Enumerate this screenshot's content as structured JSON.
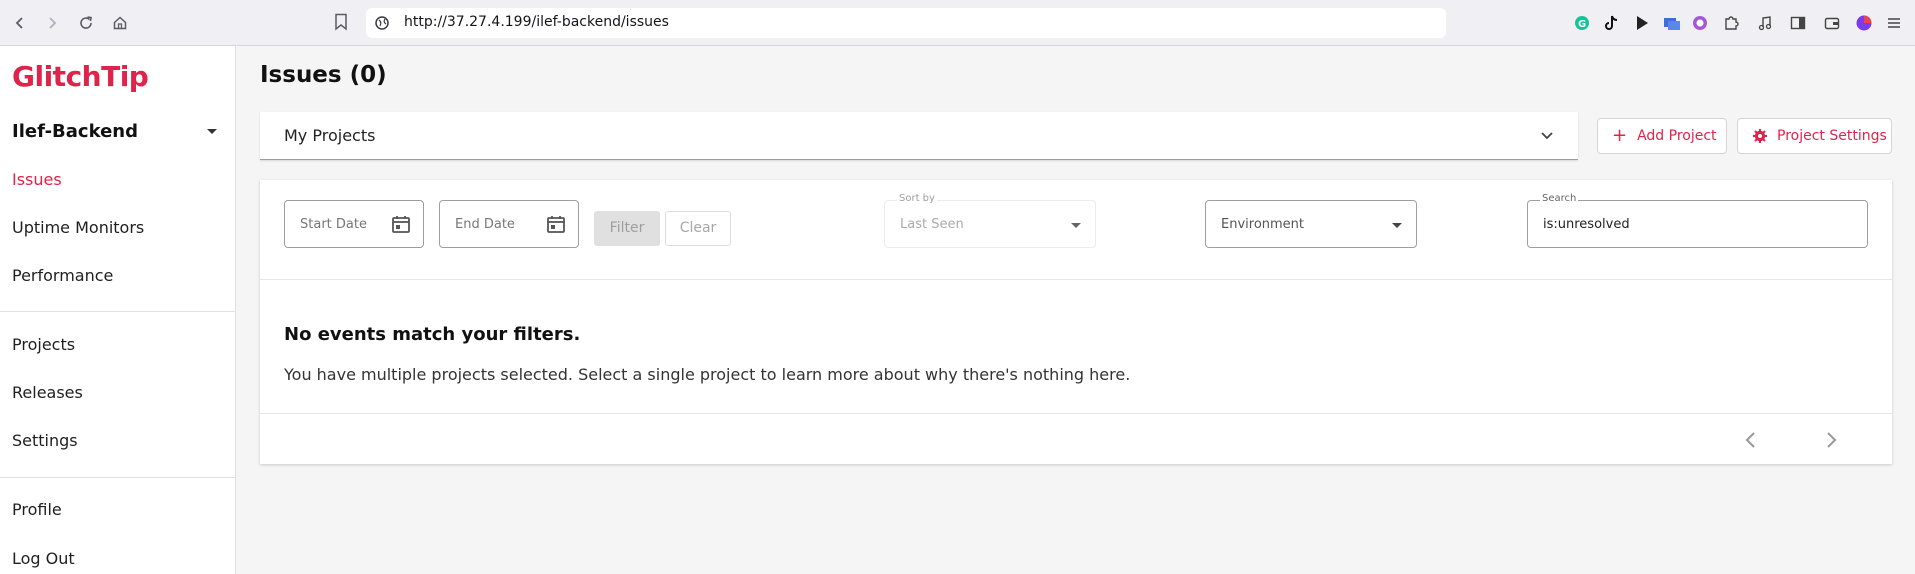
{
  "browser": {
    "url": "http://37.27.4.199/ilef-backend/issues"
  },
  "sidebar": {
    "logo": "GlitchTip",
    "organization": "Ilef-Backend",
    "items": [
      {
        "label": "Issues",
        "active": true
      },
      {
        "label": "Uptime Monitors"
      },
      {
        "label": "Performance"
      },
      {
        "label": "Projects"
      },
      {
        "label": "Releases"
      },
      {
        "label": "Settings"
      },
      {
        "label": "Profile"
      },
      {
        "label": "Log Out"
      }
    ]
  },
  "main": {
    "title": "Issues (0)",
    "project_select": "My Projects",
    "add_project": "Add Project",
    "project_settings": "Project Settings",
    "filters": {
      "start_date": "Start Date",
      "end_date": "End Date",
      "filter_btn": "Filter",
      "clear_btn": "Clear",
      "sort_label": "Sort by",
      "sort_value": "Last Seen",
      "environment": "Environment",
      "search_label": "Search",
      "search_value": "is:unresolved"
    },
    "empty": {
      "title": "No events match your filters.",
      "text": "You have multiple projects selected. Select a single project to learn more about why there's nothing here."
    }
  },
  "colors": {
    "brand": "#e0234b"
  }
}
